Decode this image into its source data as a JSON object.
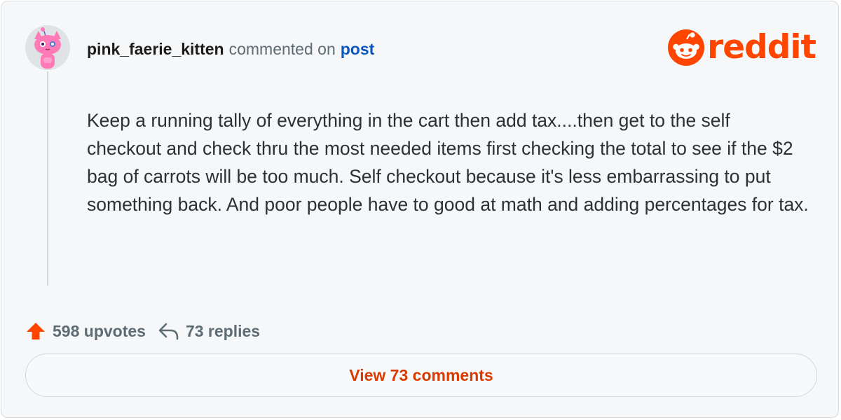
{
  "comment": {
    "username": "pink_faerie_kitten",
    "action": "commented on",
    "target_link": "post",
    "body": "Keep a running tally of everything in the cart then add tax....then get to the self checkout and check thru the most needed items first checking the total to see if the $2 bag of carrots will be too much. Self checkout because it's less embarrassing to put something back. And poor people have to good at math and adding percentages for tax."
  },
  "brand": {
    "wordmark": "reddit",
    "color": "#ff4500"
  },
  "stats": {
    "upvotes": "598 upvotes",
    "replies": "73 replies"
  },
  "cta": {
    "label": "View 73 comments"
  },
  "icons": {
    "avatar": "pink-cat-snoo-avatar",
    "logo": "reddit-snoo-icon",
    "upvote": "upvote-arrow-icon",
    "reply": "reply-arrow-icon"
  },
  "colors": {
    "accent": "#ff4500",
    "link": "#0a57c2",
    "cta_text": "#d93a00",
    "card_bg": "#f6f7f8"
  }
}
